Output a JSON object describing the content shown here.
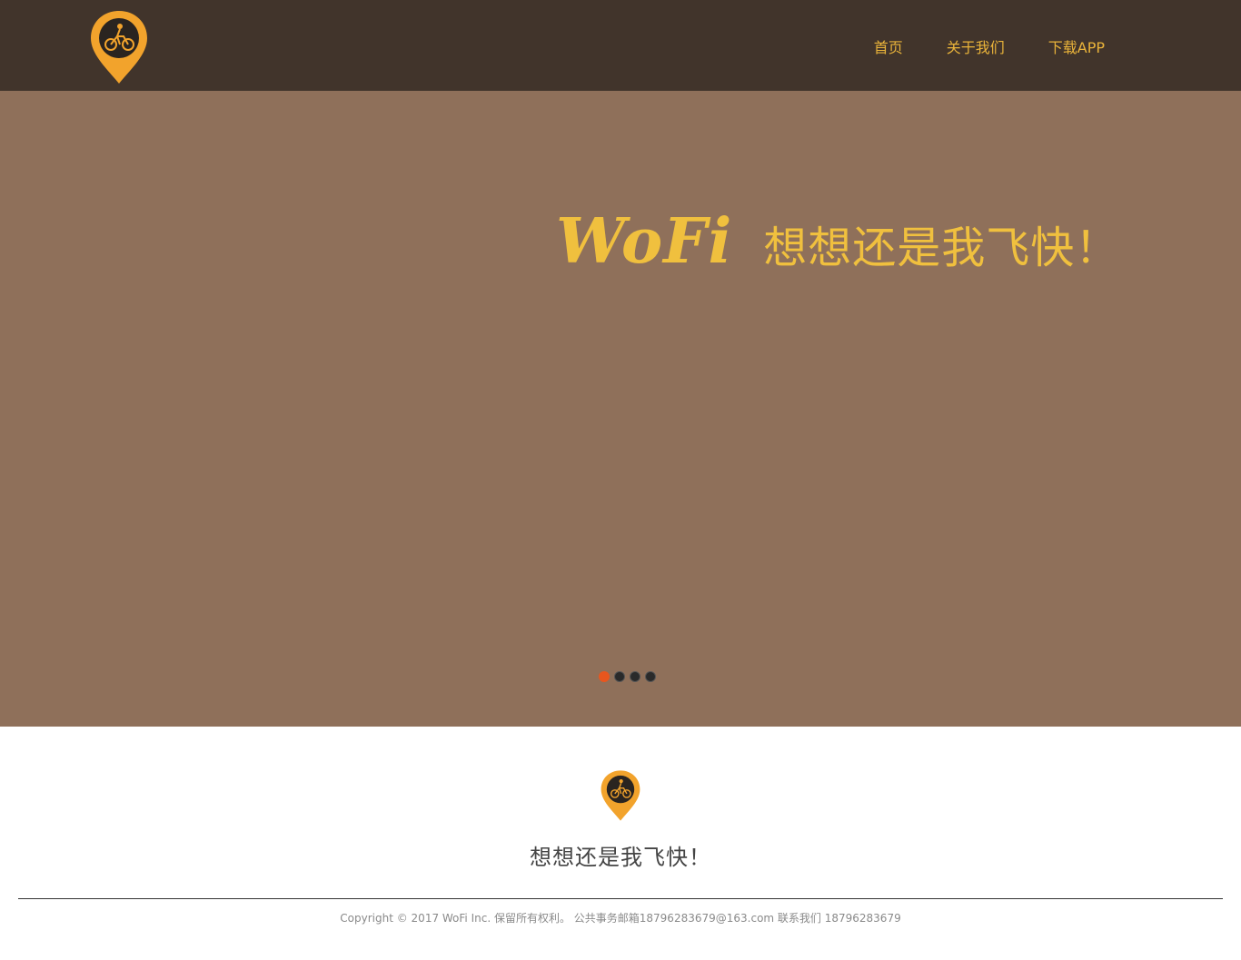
{
  "nav": {
    "items": [
      {
        "label": "首页"
      },
      {
        "label": "关于我们"
      },
      {
        "label": "下载APP"
      }
    ]
  },
  "hero": {
    "brand": "WoFi",
    "slogan": "想想还是我飞快！",
    "slides": 4,
    "active_slide": 1
  },
  "intro": {
    "slogan": "想想还是我飞快！"
  },
  "footer": {
    "text": "Copyright © 2017 WoFi Inc. 保留所有权利。 公共事务邮箱18796283679@163.com 联系我们 18796283679"
  },
  "colors": {
    "accent": "#f0c03e",
    "nav_text": "#e9b33a",
    "logo_orange": "#f2a32c",
    "active_dot": "#e8561e"
  }
}
